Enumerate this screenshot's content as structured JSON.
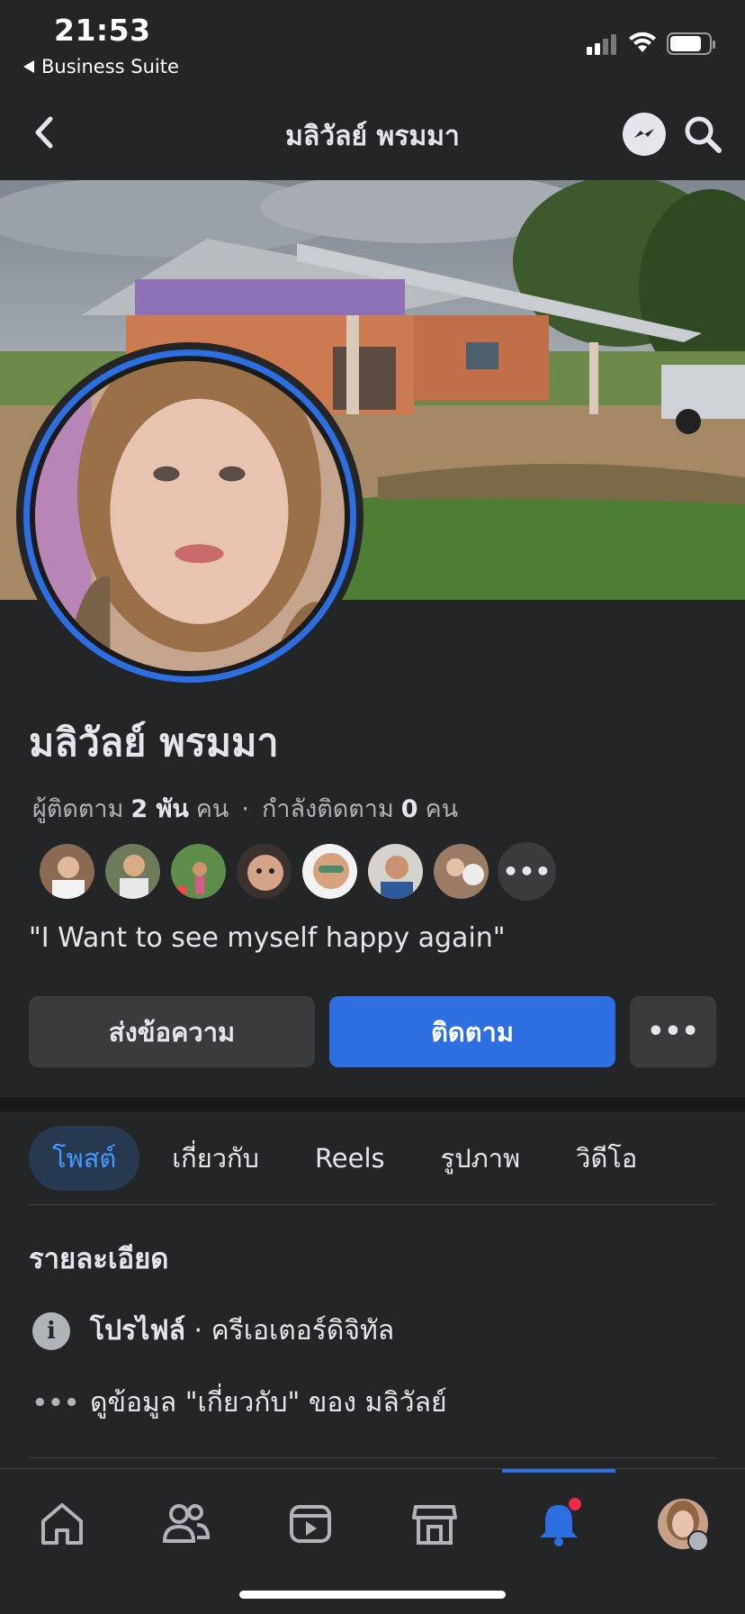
{
  "status": {
    "time": "21:53",
    "back_app": "Business Suite"
  },
  "header": {
    "title": "มลิวัลย์ พรมมา"
  },
  "profile": {
    "name": "มลิวัลย์ พรมมา",
    "followers_label": "ผู้ติดตาม",
    "followers_count": "2 พัน",
    "followers_unit": "คน",
    "following_label": "กำลังติดตาม",
    "following_count": "0",
    "following_unit": "คน",
    "bio": "\"I Want to see myself happy again\"",
    "more_friends": "•••"
  },
  "actions": {
    "message": "ส่งข้อความ",
    "follow": "ติดตาม",
    "more": "•••"
  },
  "tabs": [
    {
      "label": "โพสต์",
      "active": true
    },
    {
      "label": "เกี่ยวกับ",
      "active": false
    },
    {
      "label": "Reels",
      "active": false
    },
    {
      "label": "รูปภาพ",
      "active": false
    },
    {
      "label": "วิดีโอ",
      "active": false
    }
  ],
  "details": {
    "title": "รายละเอียด",
    "row1_bold": "โปรไฟล์",
    "row1_rest": "· ครีเอเตอร์ดิจิทัล",
    "row2": "ดูข้อมูล \"เกี่ยวกับ\" ของ มลิวัลย์",
    "info_glyph": "i",
    "dots_glyph": "•••"
  },
  "colors": {
    "background": "#242526",
    "accent": "#2d6ee0",
    "notification": "#f02849"
  },
  "icons": [
    "back-icon",
    "messenger-icon",
    "search-icon",
    "info-icon",
    "home-icon",
    "friends-icon",
    "video-icon",
    "marketplace-icon",
    "notifications-icon"
  ]
}
